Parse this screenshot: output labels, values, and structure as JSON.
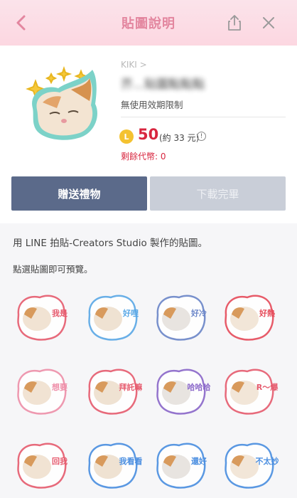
{
  "header": {
    "title": "貼圖說明",
    "icons": [
      "chevron-left-icon",
      "share-icon",
      "close-icon"
    ]
  },
  "product": {
    "author": "KIKI >",
    "name": "芥...貼圖點點點",
    "validity": "無使用效期限制",
    "coin_letter": "L",
    "price": "50",
    "price_approx": "(約 33 元)",
    "info_symbol": "!",
    "remaining": "剩餘代幣: 0"
  },
  "buttons": {
    "gift": "贈送禮物",
    "download": "下載完畢"
  },
  "description": {
    "line1": "用 LINE 拍貼-Creators Studio 製作的貼圖。",
    "line2": "點選貼圖即可預覽。"
  },
  "stickers": [
    {
      "text": "我是",
      "accent": "#e65b6e"
    },
    {
      "text": "好哩",
      "accent": "#5aa8e6"
    },
    {
      "text": "好冷",
      "accent": "#6b86c8"
    },
    {
      "text": "好熱",
      "accent": "#e64b5a"
    },
    {
      "text": "想要",
      "accent": "#ee8fa9"
    },
    {
      "text": "拜託嘛",
      "accent": "#e65b6e"
    },
    {
      "text": "哈哈哈",
      "accent": "#8a67c9"
    },
    {
      "text": "R～爆",
      "accent": "#e65b6e"
    },
    {
      "text": "回我",
      "accent": "#e65b6e"
    },
    {
      "text": "我看看",
      "accent": "#4a8ee0"
    },
    {
      "text": "還好",
      "accent": "#4a8ee0"
    },
    {
      "text": "不太妙",
      "accent": "#4a8ee0"
    }
  ],
  "colors": {
    "header_bg": "#fcd7e1",
    "header_text": "#e3869f",
    "gift_button": "#5b6a8a",
    "download_button": "#c9ced8",
    "price": "#d8263f",
    "coin": "#f4c230"
  }
}
